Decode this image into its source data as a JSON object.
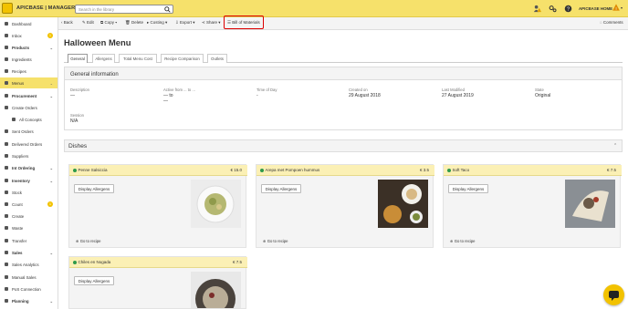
{
  "app": {
    "brand": "APICBASE | MANAGER",
    "search_placeholder": "Search in the library",
    "home_label": "APICBASE HOME"
  },
  "sidebar": {
    "items": [
      {
        "name": "sb-dashboard",
        "label": "Dashboard",
        "kind": "top"
      },
      {
        "name": "sb-inbox",
        "label": "Inbox",
        "kind": "top",
        "badge": "1"
      },
      {
        "name": "sb-products",
        "label": "Products",
        "kind": "section",
        "chev": "⌄"
      },
      {
        "name": "sb-ingredients",
        "label": "Ingredients",
        "kind": "top"
      },
      {
        "name": "sb-recipes",
        "label": "Recipes",
        "kind": "top"
      },
      {
        "name": "sb-menus",
        "label": "Menus",
        "kind": "active",
        "chev": "⌄"
      },
      {
        "name": "sb-procurement",
        "label": "Procurement",
        "kind": "section",
        "chev": "⌄"
      },
      {
        "name": "sb-create-orders",
        "label": "Create Orders",
        "kind": "top"
      },
      {
        "name": "sb-all-concepts",
        "label": "All Concepts",
        "kind": "sub"
      },
      {
        "name": "sb-sent-orders",
        "label": "Sent Orders",
        "kind": "top"
      },
      {
        "name": "sb-delivered-orders",
        "label": "Delivered Orders",
        "kind": "top"
      },
      {
        "name": "sb-suppliers",
        "label": "Suppliers",
        "kind": "top"
      },
      {
        "name": "sb-int-ordering",
        "label": "Int Ordering",
        "kind": "section",
        "chev": "⌄"
      },
      {
        "name": "sb-inventory",
        "label": "Inventory",
        "kind": "section",
        "chev": "⌄"
      },
      {
        "name": "sb-stock",
        "label": "Stock",
        "kind": "top"
      },
      {
        "name": "sb-count",
        "label": "Count",
        "kind": "top",
        "badge": "1"
      },
      {
        "name": "sb-create",
        "label": "Create",
        "kind": "top"
      },
      {
        "name": "sb-waste",
        "label": "Waste",
        "kind": "top"
      },
      {
        "name": "sb-transfer",
        "label": "Transfer",
        "kind": "top"
      },
      {
        "name": "sb-sales",
        "label": "Sales",
        "kind": "section",
        "chev": "⌄"
      },
      {
        "name": "sb-sales-analytics",
        "label": "Sales Analytics",
        "kind": "top"
      },
      {
        "name": "sb-manual-sales",
        "label": "Manual Sales",
        "kind": "top"
      },
      {
        "name": "sb-pos-connection",
        "label": "PoS Connection",
        "kind": "top"
      },
      {
        "name": "sb-planning",
        "label": "Planning",
        "kind": "section",
        "chev": "⌄"
      }
    ]
  },
  "toolbar": {
    "back": "‹ Back",
    "edit": "✎ Edit",
    "copy": "⧉ Copy ▾",
    "delete": "🗑 Delete",
    "costing": "▸ Costing ▾",
    "export": "⇩ Export ▾",
    "share": "⋖ Share ▾",
    "bom": "☰ Bill of Materials",
    "comments": "◌ Comments"
  },
  "page": {
    "title": "Halloween Menu"
  },
  "tabs": [
    "General",
    "Allergens",
    "Total Menu Cost",
    "Recipe Comparison",
    "Outlets"
  ],
  "general": {
    "title": "General information",
    "description": {
      "label": "Description",
      "value": "—"
    },
    "active_from": {
      "label": "Active from ... to ...",
      "value": "— to",
      "value2": "—"
    },
    "time_of_day": {
      "label": "Time of Day",
      "value": "-"
    },
    "created_on": {
      "label": "Created on",
      "value": "29 August 2018"
    },
    "last_modified": {
      "label": "Last Modified",
      "value": "27 August 2019"
    },
    "state": {
      "label": "State",
      "value": "Original"
    },
    "session": {
      "label": "Session",
      "value": "N/A"
    }
  },
  "dishes": {
    "title": "Dishes",
    "allergen_button": "Display Allergens",
    "goto_label": "Go to recipe",
    "items": [
      {
        "name": "Penne Salsiccia",
        "price": "€ 15.0"
      },
      {
        "name": "Arepa met Pompoen hummus",
        "price": "€ 3.5"
      },
      {
        "name": "Soft Taco",
        "price": "€ 7.5"
      },
      {
        "name": "Chiles en Nogada",
        "price": "€ 7.5"
      }
    ]
  },
  "colors": {
    "brand_yellow": "#f6e16b",
    "accent": "#f2c200",
    "highlight_red": "#dd0000",
    "veg_green": "#2e9a4a"
  }
}
